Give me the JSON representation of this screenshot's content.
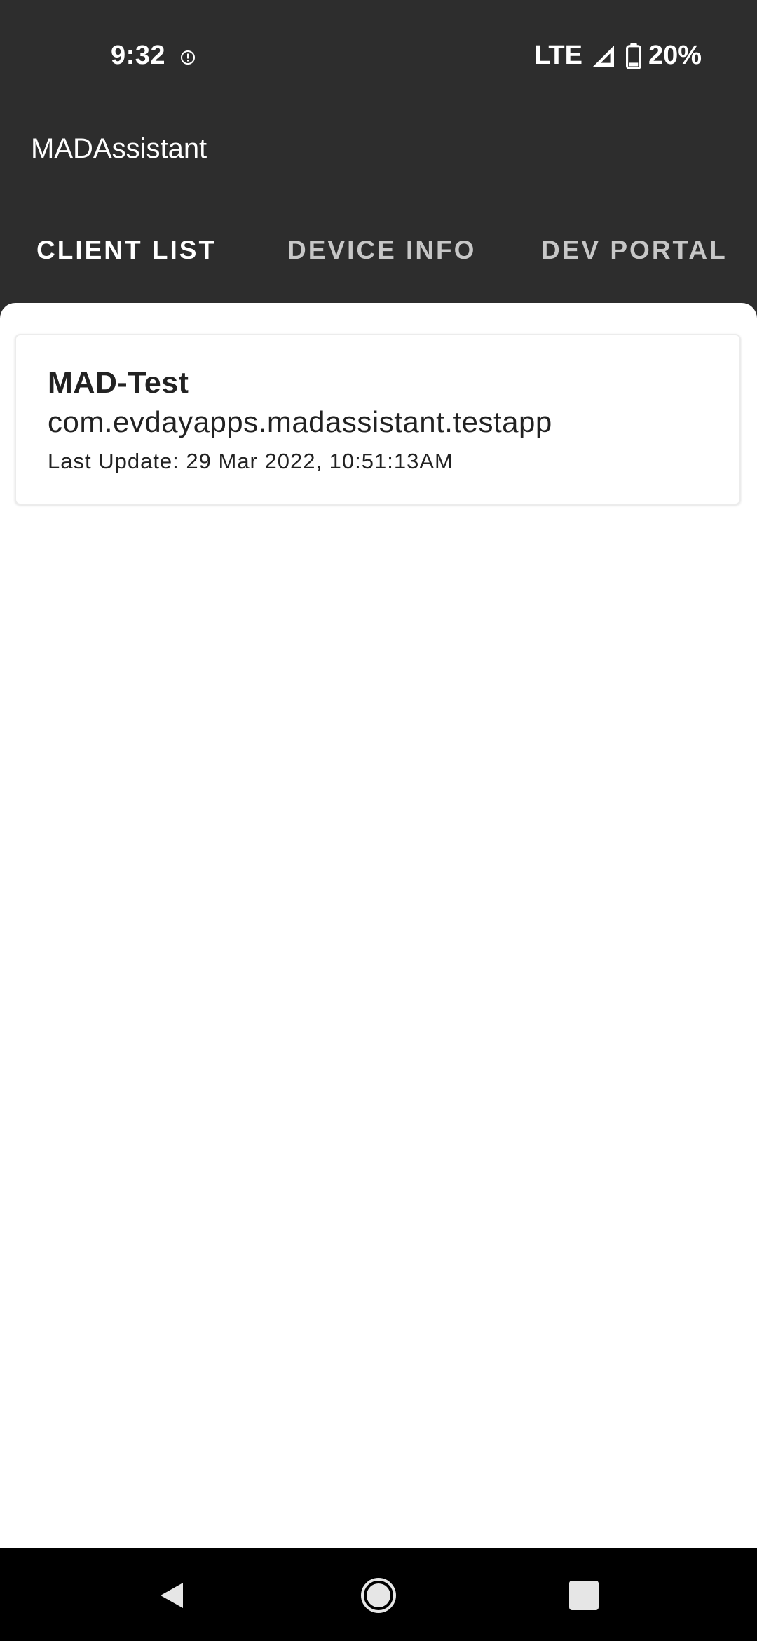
{
  "status_bar": {
    "time": "9:32",
    "network": "LTE",
    "battery": "20%",
    "icons": [
      "alert-circle-icon",
      "signal-icon",
      "battery-icon"
    ]
  },
  "app_bar": {
    "title": "MADAssistant"
  },
  "tabs": [
    {
      "label": "CLIENT LIST",
      "active": true
    },
    {
      "label": "DEVICE INFO",
      "active": false
    },
    {
      "label": "DEV PORTAL",
      "active": false
    }
  ],
  "clients": [
    {
      "name": "MAD-Test",
      "package": "com.evdayapps.madassistant.testapp",
      "last_update": "Last Update: 29 Mar 2022, 10:51:13AM"
    }
  ],
  "nav_bar": {
    "icons": [
      "back-icon",
      "home-icon",
      "recents-icon"
    ]
  },
  "colors": {
    "app_bar_bg": "#2d2d2d",
    "content_bg": "#ffffff",
    "text_primary": "#222222",
    "tab_inactive": "#c7c7c7",
    "nav_bar_bg": "#000000"
  }
}
